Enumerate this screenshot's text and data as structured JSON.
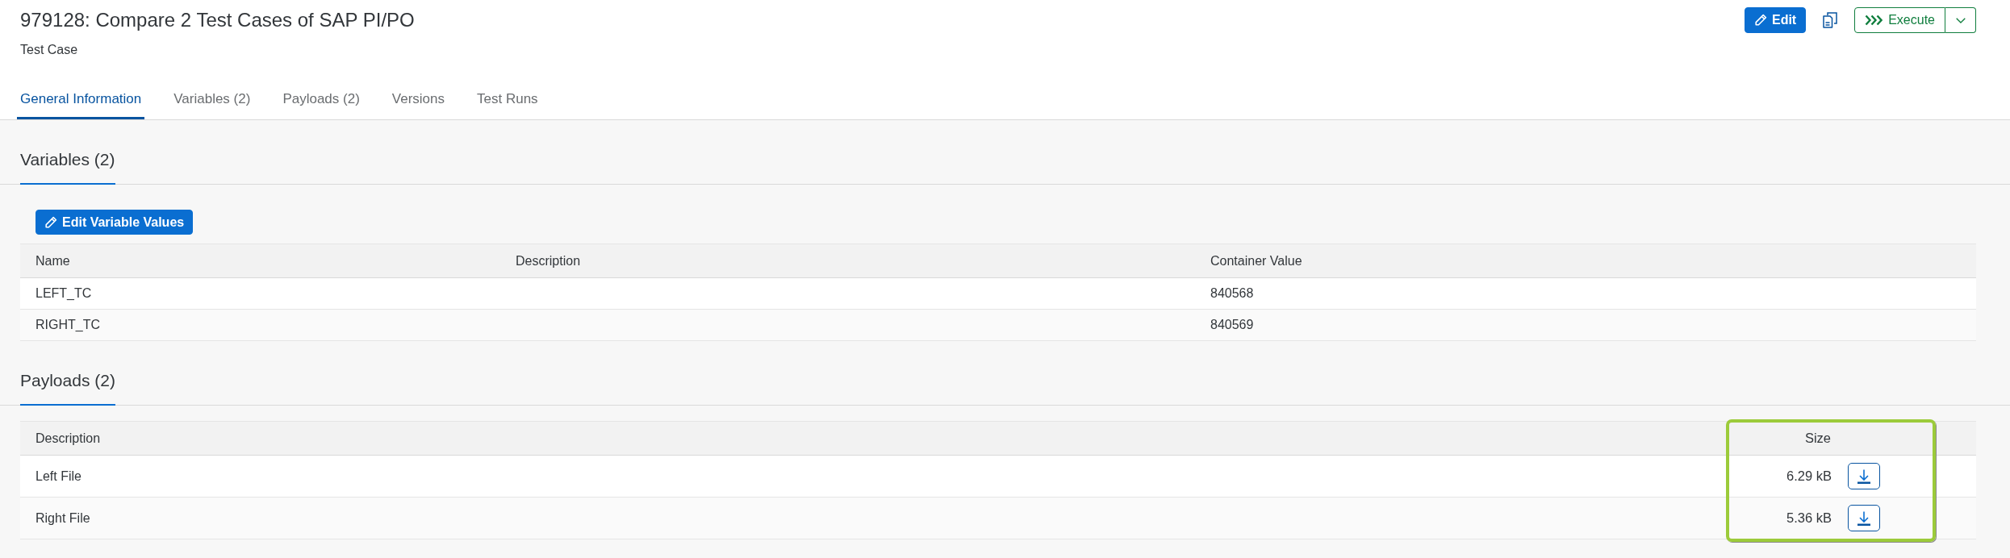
{
  "header": {
    "title": "979128: Compare 2 Test Cases of SAP PI/PO",
    "subtitle": "Test Case",
    "actions": [
      {
        "kind": "edit",
        "label": "Edit"
      },
      {
        "kind": "copy"
      },
      {
        "kind": "execute",
        "label": "Execute"
      }
    ]
  },
  "tabs": [
    {
      "label": "General Information",
      "selected": true
    },
    {
      "label": "Variables (2)",
      "selected": false
    },
    {
      "label": "Payloads (2)",
      "selected": false
    },
    {
      "label": "Versions",
      "selected": false
    },
    {
      "label": "Test Runs",
      "selected": false
    }
  ],
  "variables": {
    "title": "Variables (2)",
    "edit_button": "Edit Variable Values",
    "columns": [
      {
        "label": "Name"
      },
      {
        "label": "Description"
      },
      {
        "label": "Container Value"
      }
    ],
    "rows": [
      {
        "name": "LEFT_TC",
        "container_value": "840568"
      },
      {
        "name": "RIGHT_TC",
        "container_value": "840569"
      }
    ]
  },
  "payloads": {
    "title": "Payloads (2)",
    "columns": [
      {
        "label": "Description",
        "highlighted": false
      },
      {
        "label": "Size",
        "highlighted": true
      }
    ],
    "rows": [
      {
        "description": "Left File",
        "size": "6.29 kB"
      },
      {
        "description": "Right File",
        "size": "5.36 kB"
      }
    ]
  }
}
